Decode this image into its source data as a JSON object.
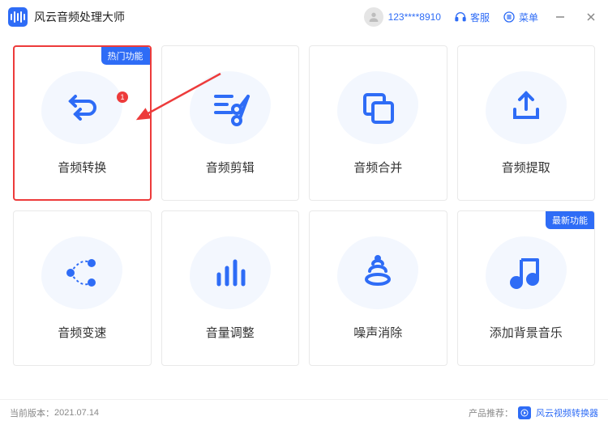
{
  "header": {
    "app_title": "风云音频处理大师",
    "username": "123****8910",
    "support_label": "客服",
    "menu_label": "菜单"
  },
  "badges": {
    "hot": "热门功能",
    "new": "最新功能"
  },
  "cards": [
    {
      "label": "音频转换",
      "icon": "convert-icon",
      "badge": "hot",
      "highlighted": true
    },
    {
      "label": "音频剪辑",
      "icon": "cut-icon"
    },
    {
      "label": "音频合并",
      "icon": "merge-icon"
    },
    {
      "label": "音频提取",
      "icon": "extract-icon"
    },
    {
      "label": "音频变速",
      "icon": "speed-icon"
    },
    {
      "label": "音量调整",
      "icon": "volume-icon"
    },
    {
      "label": "噪声消除",
      "icon": "denoise-icon"
    },
    {
      "label": "添加背景音乐",
      "icon": "music-icon",
      "badge": "new"
    }
  ],
  "annotation": {
    "num": "1"
  },
  "footer": {
    "version_label": "当前版本：",
    "version": "2021.07.14",
    "recommend_label": "产品推荐：",
    "recommend_product": "风云视频转换器"
  },
  "colors": {
    "accent": "#2e6cf6",
    "highlight": "#ed3b3b"
  }
}
